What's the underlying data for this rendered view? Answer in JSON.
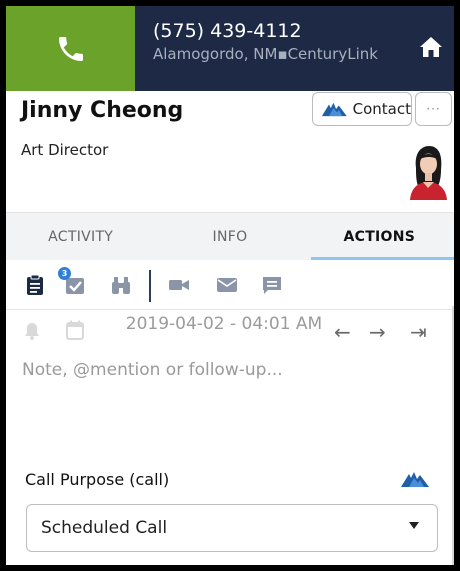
{
  "call_bar": {
    "phone_number": "(575) 439-4112",
    "location_carrier": "Alamogordo, NM▪CenturyLink"
  },
  "contact": {
    "name": "Jinny Cheong",
    "title": "Art Director",
    "contact_button_label": "Contact",
    "more_button_label": "···"
  },
  "tabs": [
    {
      "label": "ACTIVITY",
      "active": false
    },
    {
      "label": "INFO",
      "active": false
    },
    {
      "label": "ACTIONS",
      "active": true
    }
  ],
  "toolbar": {
    "tools": [
      "clipboard-icon",
      "task-check-icon",
      "binoculars-icon",
      "video-icon",
      "mail-icon",
      "chat-icon"
    ],
    "task_badge_count": "3"
  },
  "schedule": {
    "datetime": "2019-04-02 - 04:01 AM",
    "nav": [
      "←",
      "→",
      "⇥"
    ]
  },
  "note": {
    "placeholder": "Note, @mention or follow-up..."
  },
  "call_purpose": {
    "label": "Call Purpose (call)",
    "selected": "Scheduled Call"
  },
  "colors": {
    "call_green": "#6aa22a",
    "navy": "#1e2a45",
    "accent_blue": "#2f7fd6",
    "tab_underline": "#8ec6f0"
  }
}
